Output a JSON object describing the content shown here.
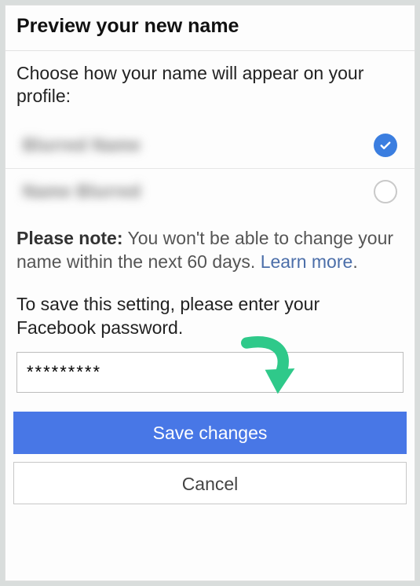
{
  "title": "Preview your new name",
  "instruction": "Choose how your name will appear on your profile:",
  "options": [
    {
      "label": "Blurred Name",
      "selected": true
    },
    {
      "label": "Name Blurred",
      "selected": false
    }
  ],
  "note": {
    "prefix": "Please note:",
    "body": " You won't be able to change your name within the next 60 days. ",
    "link": "Learn more",
    "suffix": "."
  },
  "save_instruction": "To save this setting, please enter your Facebook password.",
  "password_value": "*********",
  "buttons": {
    "save": "Save changes",
    "cancel": "Cancel"
  },
  "colors": {
    "primary": "#4877e6",
    "check_bg": "#3b7ee0",
    "link": "#4b6ea9",
    "arrow": "#2fc98a"
  }
}
